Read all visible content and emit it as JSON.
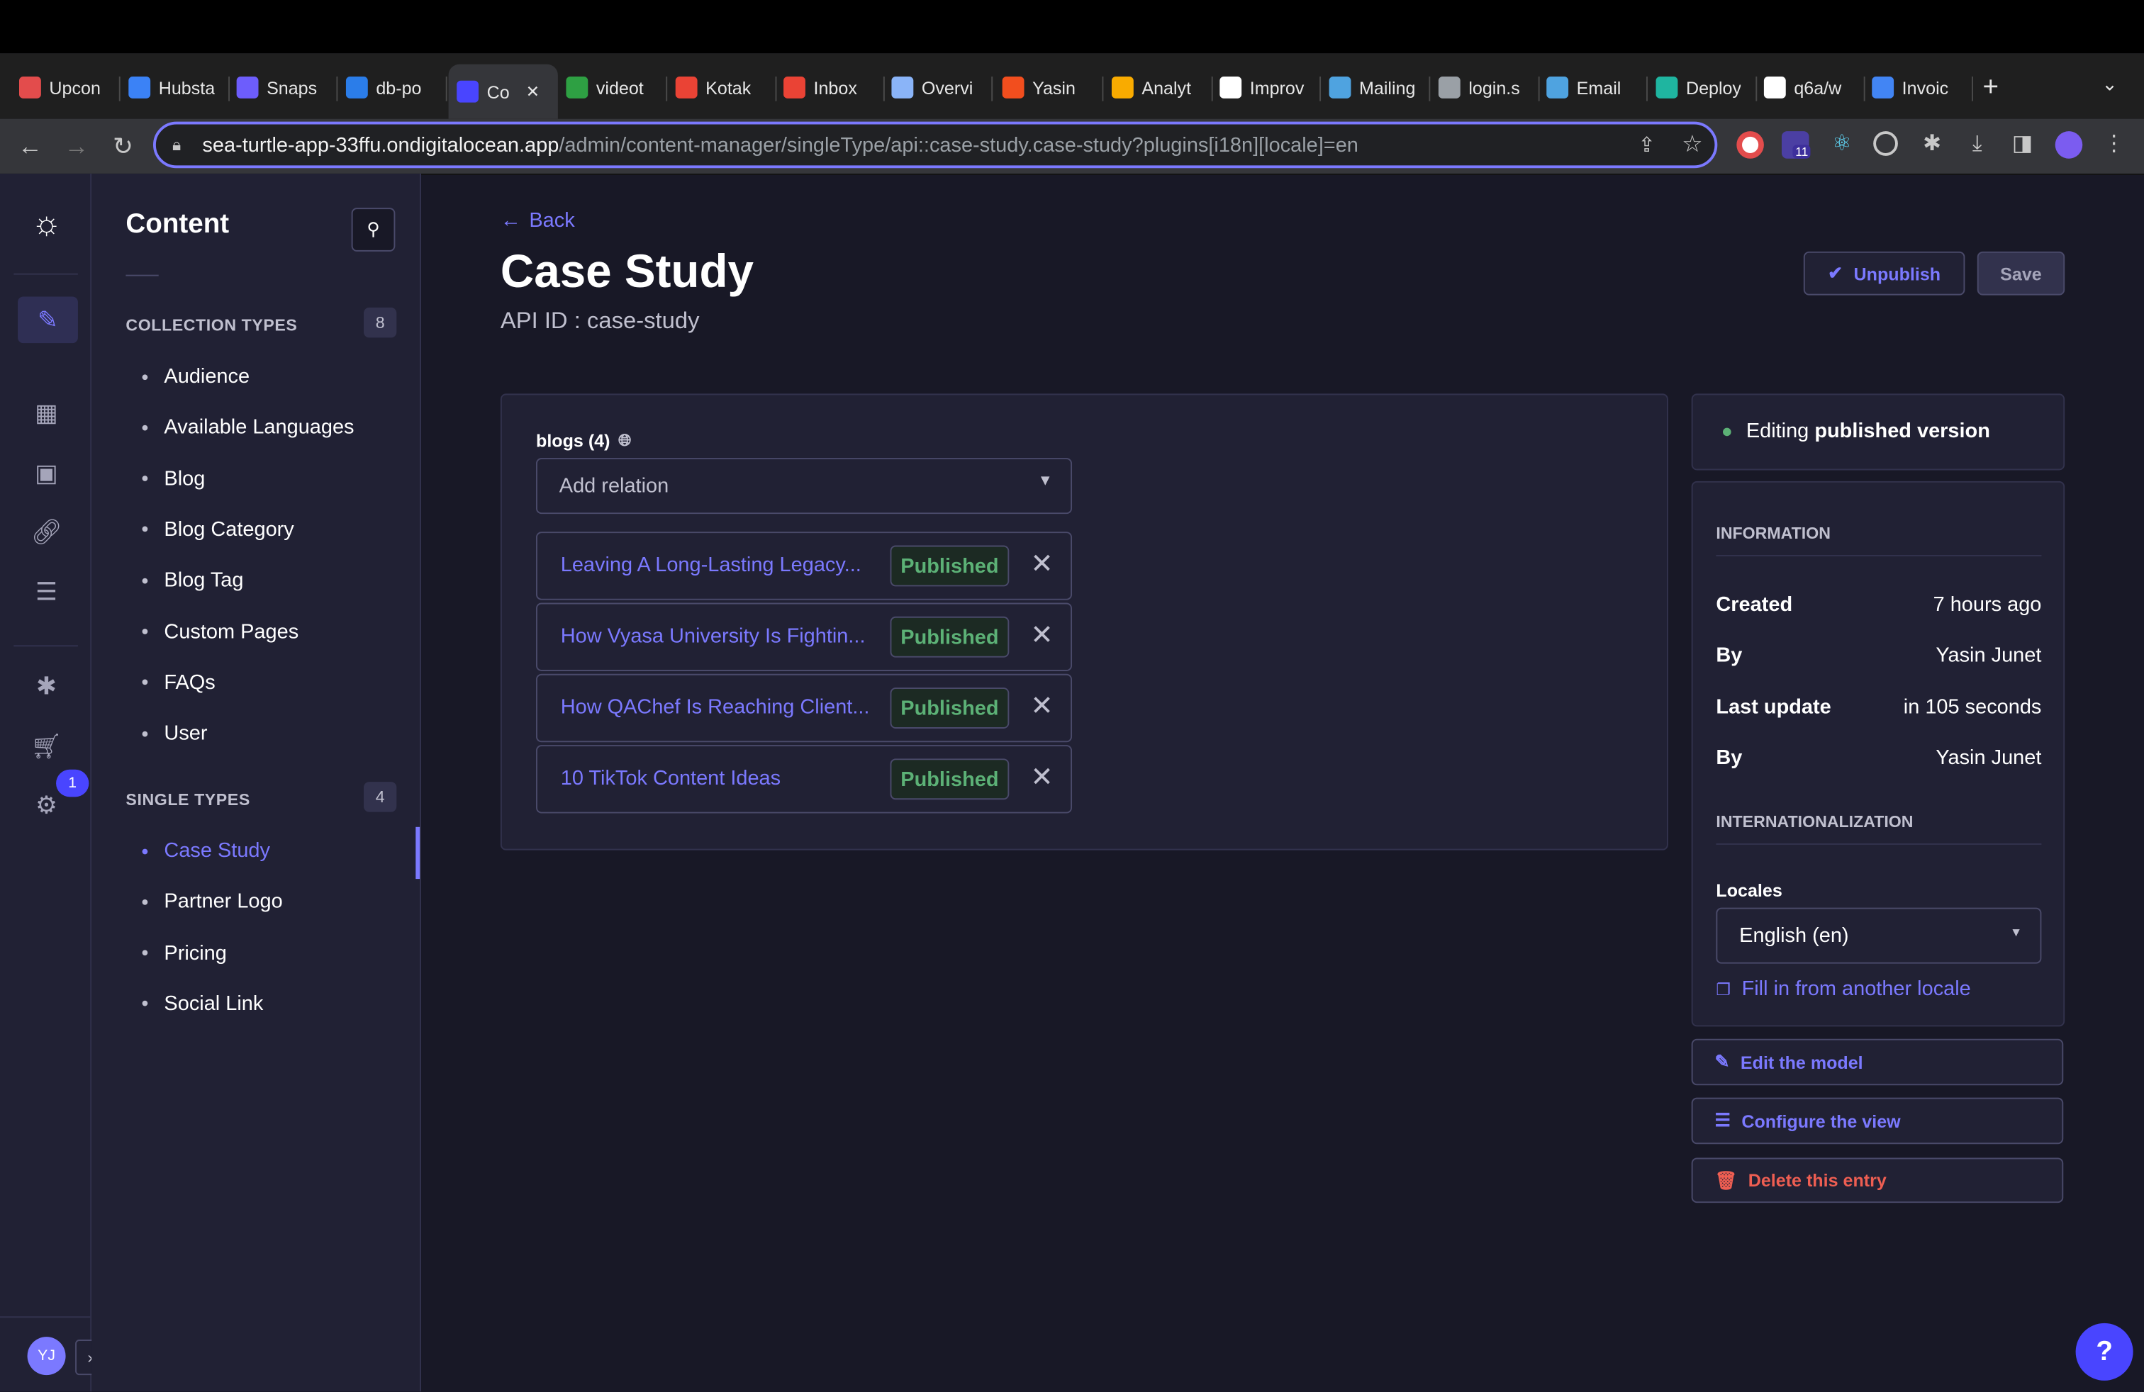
{
  "browser": {
    "tabs": [
      {
        "label": "Upcon",
        "color": "#e34c4c"
      },
      {
        "label": "Hubsta",
        "color": "#3b82f6"
      },
      {
        "label": "Snaps",
        "color": "#6d5dfc"
      },
      {
        "label": "db-po",
        "color": "#2b7de9"
      },
      {
        "label": "Co",
        "color": "#4945ff"
      },
      {
        "label": "videot",
        "color": "#2ea043"
      },
      {
        "label": "Kotak",
        "color": "#ea4335"
      },
      {
        "label": "Inbox",
        "color": "#ea4335"
      },
      {
        "label": "Overvi",
        "color": "#8ab4f8"
      },
      {
        "label": "Yasin",
        "color": "#f24e1e"
      },
      {
        "label": "Analyt",
        "color": "#f9ab00"
      },
      {
        "label": "Improv",
        "color": "#ffffff"
      },
      {
        "label": "Mailing",
        "color": "#4fa3e0"
      },
      {
        "label": "login.s",
        "color": "#9aa0a6"
      },
      {
        "label": "Email",
        "color": "#4fa3e0"
      },
      {
        "label": "Deploy",
        "color": "#1fb5a0"
      },
      {
        "label": "q6a/w",
        "color": "#ffffff"
      },
      {
        "label": "Invoic",
        "color": "#4285f4"
      }
    ],
    "url_host": "sea-turtle-app-33ffu.ondigitalocean.app",
    "url_path": "/admin/content-manager/singleType/api::case-study.case-study?plugins[i18n][locale]=en",
    "ext_badge": "11"
  },
  "rail": {
    "settings_badge": "1",
    "avatar": "YJ"
  },
  "content_nav": {
    "title": "Content",
    "collection_header": "COLLECTION TYPES",
    "collection_count": "8",
    "collection_items": [
      "Audience",
      "Available Languages",
      "Blog",
      "Blog Category",
      "Blog Tag",
      "Custom Pages",
      "FAQs",
      "User"
    ],
    "single_header": "SINGLE TYPES",
    "single_count": "4",
    "single_items": [
      "Case Study",
      "Partner Logo",
      "Pricing",
      "Social Link"
    ]
  },
  "header": {
    "back": "Back",
    "title": "Case Study",
    "api_id": "API ID : case-study",
    "unpublish": "Unpublish",
    "save": "Save"
  },
  "relation": {
    "label": "blogs (4)",
    "placeholder": "Add relation",
    "items": [
      {
        "title": "Leaving A Long-Lasting Legacy...",
        "status": "Published"
      },
      {
        "title": "How Vyasa University Is Fightin...",
        "status": "Published"
      },
      {
        "title": "How QAChef Is Reaching Client...",
        "status": "Published"
      },
      {
        "title": "10 TikTok Content Ideas",
        "status": "Published"
      }
    ]
  },
  "side": {
    "editing_prefix": "Editing ",
    "editing_bold": "published version",
    "info_header": "INFORMATION",
    "rows": [
      {
        "k": "Created",
        "v": "7 hours ago"
      },
      {
        "k": "By",
        "v": "Yasin Junet"
      },
      {
        "k": "Last update",
        "v": "in 105 seconds"
      },
      {
        "k": "By",
        "v": "Yasin Junet"
      }
    ],
    "intl_header": "INTERNATIONALIZATION",
    "locales_label": "Locales",
    "locale_value": "English (en)",
    "fill_in": "Fill in from another locale",
    "edit_model": "Edit the model",
    "configure_view": "Configure the view",
    "delete_entry": "Delete this entry"
  },
  "help": "?"
}
